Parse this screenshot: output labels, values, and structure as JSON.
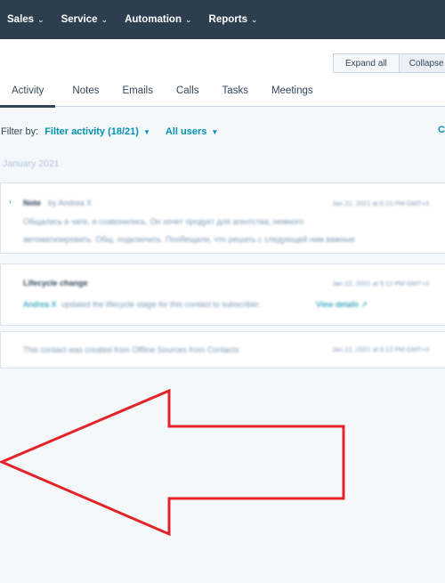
{
  "nav": {
    "items": [
      {
        "label": "Sales",
        "chevron": "⌄"
      },
      {
        "label": "Service",
        "chevron": "⌄"
      },
      {
        "label": "Automation",
        "chevron": "⌄"
      },
      {
        "label": "Reports",
        "chevron": "⌄"
      }
    ]
  },
  "toolbar": {
    "expand_all": "Expand all",
    "collapse_all": "Collapse all"
  },
  "tabs": [
    {
      "label": "Activity",
      "active": true
    },
    {
      "label": "Notes",
      "active": false
    },
    {
      "label": "Emails",
      "active": false
    },
    {
      "label": "Calls",
      "active": false
    },
    {
      "label": "Tasks",
      "active": false
    },
    {
      "label": "Meetings",
      "active": false
    }
  ],
  "filter": {
    "label": "Filter by:",
    "activity": "Filter activity (18/21)",
    "users": "All users",
    "caret": "▼",
    "edge_text": "C"
  },
  "timeline": {
    "month": "January 2021",
    "entries": [
      {
        "title": "Note",
        "author": "by Andrea X",
        "timestamp": "Jan 22, 2021 at 6:15 PM GMT+3",
        "line1": "Общались в чате, и созвонились. Он хочет продукт для агентства, немного",
        "line2": "автоматизировать. Общ. подключить. Пообещали, что решать с следующей ним важные",
        "caret": "›"
      },
      {
        "title": "Lifecycle change",
        "timestamp": "Jan 22, 2021 at 5:12 PM GMT+3",
        "actor": "Andrea X",
        "text": "updated the lifecycle stage for this contact to subscriber.",
        "link": "View details ↗"
      },
      {
        "text": "This contact was created from Offline Sources from Contacts",
        "timestamp": "Jan 22, 2021 at 5:12 PM GMT+3"
      }
    ]
  },
  "annotation": {
    "arrow_color": "#e3232a",
    "shape": "left-pointing-arrow"
  }
}
